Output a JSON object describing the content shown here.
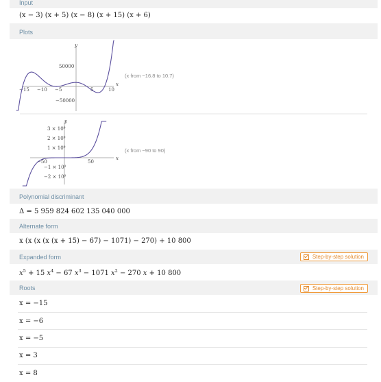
{
  "input": {
    "header": "Input",
    "expression": "(x − 3) (x + 5) (x − 8) (x + 15) (x + 6)"
  },
  "plots": {
    "header": "Plots",
    "plot1": {
      "range_note": "(x from −16.8 to 10.7)",
      "y_label": "y",
      "x_label": "x",
      "x_ticks": [
        "−15",
        "−10",
        "−5",
        "5",
        "10"
      ],
      "y_ticks": [
        "50000",
        "−50000"
      ]
    },
    "plot2": {
      "range_note": "(x from −90 to 90)",
      "y_label": "y",
      "x_label": "x",
      "x_ticks": [
        "−50",
        "50"
      ],
      "y_ticks": [
        "3 × 10⁹",
        "2 × 10⁹",
        "1 × 10⁹",
        "−1 × 10⁹",
        "−2 × 10⁹"
      ]
    }
  },
  "discriminant": {
    "header": "Polynomial discriminant",
    "value": "Δ = 5 959 824 602 135 040 000"
  },
  "alternate": {
    "header": "Alternate form",
    "value": "x (x (x (x (x + 15) − 67) − 1071) − 270) + 10 800"
  },
  "expanded": {
    "header": "Expanded form",
    "button": "Step-by-step solution"
  },
  "roots": {
    "header": "Roots",
    "button": "Step-by-step solution",
    "items": [
      "x = −15",
      "x = −6",
      "x = −5",
      "x = 3",
      "x = 8"
    ]
  },
  "colors": {
    "curve": "#5b4f9e",
    "header_text": "#6d8ea5",
    "button": "#e38a2d"
  }
}
